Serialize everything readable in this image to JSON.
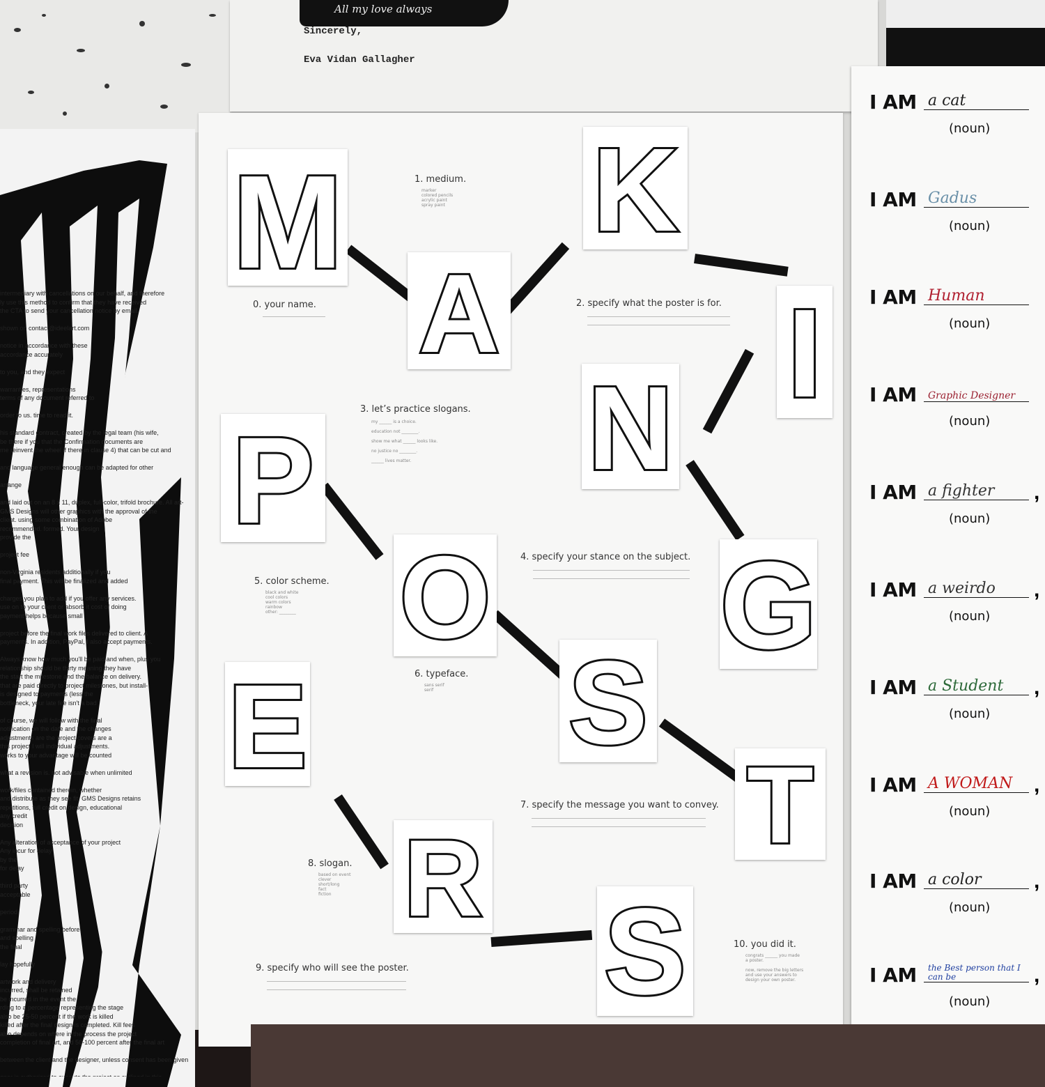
{
  "letter": {
    "script_line": "All my love always",
    "closing": "Sincerely,",
    "signature": "Eva Vidan Gallagher"
  },
  "poster": {
    "big_letters": [
      "M",
      "A",
      "K",
      "I",
      "N",
      "G",
      "P",
      "O",
      "S",
      "T",
      "E",
      "R",
      "S"
    ],
    "steps": {
      "s0": "0. your name.",
      "s1": "1. medium.",
      "s2": "2. specify what the poster is for.",
      "s3": "3. let’s practice slogans.",
      "s4": "4. specify your stance on the subject.",
      "s5": "5. color scheme.",
      "s6": "6. typeface.",
      "s7": "7. specify the message you want to convey.",
      "s8": "8. slogan.",
      "s9": "9. specify who will see the poster.",
      "s10": "10. you did it."
    },
    "medium_options": "marker\ncolored pencils\nacrylic paint\nspray paint",
    "slogan_practice": "my ______ is a choice.\n\neducation not ________.\n\nshow me what ______ looks like.\n\nno justice no ________.\n\n______ lives matter.",
    "color_options": "black and white\ncool colors\nwarm colors\nrainbow\nother: ________",
    "typeface_options": "sans serif\nserif",
    "slogan_options": "based on event\nclever\nshort/long\nfact\nfiction",
    "done_text": "congrats ______ you made\na poster.\n\nnow, remove the big letters\nand use your answers to\ndesign your own poster."
  },
  "sheet": {
    "prefix": "I AM",
    "noun_label": "(noun)",
    "answers": [
      {
        "text": "a cat",
        "color": "#222222"
      },
      {
        "text": "Gadus",
        "color": "#6a90a8"
      },
      {
        "text": "Human",
        "color": "#b02030"
      },
      {
        "text": "Graphic Designer",
        "color": "#9a2030"
      },
      {
        "text": "a fighter",
        "color": "#333333"
      },
      {
        "text": "a weirdo",
        "color": "#333333"
      },
      {
        "text": "a Student",
        "color": "#2e6a3a"
      },
      {
        "text": "A WOMAN",
        "color": "#c01818"
      },
      {
        "text": "a color",
        "color": "#222222"
      },
      {
        "text": "the Best person that I can be",
        "color": "#2040a0"
      }
    ]
  },
  "zebra": {
    "copy": "intermediary with cancellations on our behalf, and therefore\nly use this method to confirm that they have received\nthe CTA to send your cancellation notice by email.\n\nshown on contact@ideelart.com\n\nnotice in accordance with these\naccordance accurately\n\nto you, and they expect\n\nwarranties, representations\nterms of any document referred to\n\norder to us. time to read it.\n\nhis standard contract, created by the legal team (his wife,\nbe there if you that the Confirmation documents are\nme reinvent the wheel if there in clause 4) that can be cut and\n\nand language general enough can be adapted for other\n\narrange\n\nand laid out on an 8 x 11, duplex, full-color, trifold brochure. All art-\nGMS Designs will other graphics with the approval of the\nclient. using some combination of Adobe\nrecommended. formed. Your design\nprovide the\n\nproject fee\n\nnon-Virginia residents additionally if you\nfinal payment. This will be finalized and added\n\ncharges you plan to add if you offer any services.\nuse on to your client or absorb it cost of doing\npayment helps because small\n\nproject before the final work files delivered to client. A\npayments. In addition, PayPal, I also accept payments.\n\nAlways know how much you'll be paid and when, plus you\nrelationship should be thirty meaning they have\nthe start the milestone and the balance on delivery.\nthat are paid directly to project milestones, but install-\nis designed to payments (less the\nbottleneck, your late fee isn't a bad\n\nof course, we will follow with the final\nnotification on the date and the changes\nadjustments are the project covers are a\nthis project I will individual adjustments.\nworks to your advantage will be counted\n\nwhat a revision is. not advisable when unlimited\n\nwork/files contained therein, whether\nand distribute as they see fit. GMS Designs retains\nrepetitions, full credit on design, educational\nany credit\ndecision\n\nAny alteration of acceptance of your project\nAny incur for delay\nby the\nfor delay\n\nthird party\nacceptable\n\nperiod\n\ngrammar and spelling before\nand spelling\nthe final\n\nlay hopefully\n\nartwork and delivery\nincurred, shall be retained\nbe incurred in the event the\nrding to a percentage representing the stage\nalso be 25-50 percent if the work is killed\nkilled after the final design is completed. Kill fees\nalso depends on where in the process the project\ncompletion of final art, and 50-100 percent after the final art\n\nbetween the client and the designer, unless consent has been given\n\ngner is authorized to execute the project as outlined in this agreement\ngned by client and returned to the designer."
  }
}
